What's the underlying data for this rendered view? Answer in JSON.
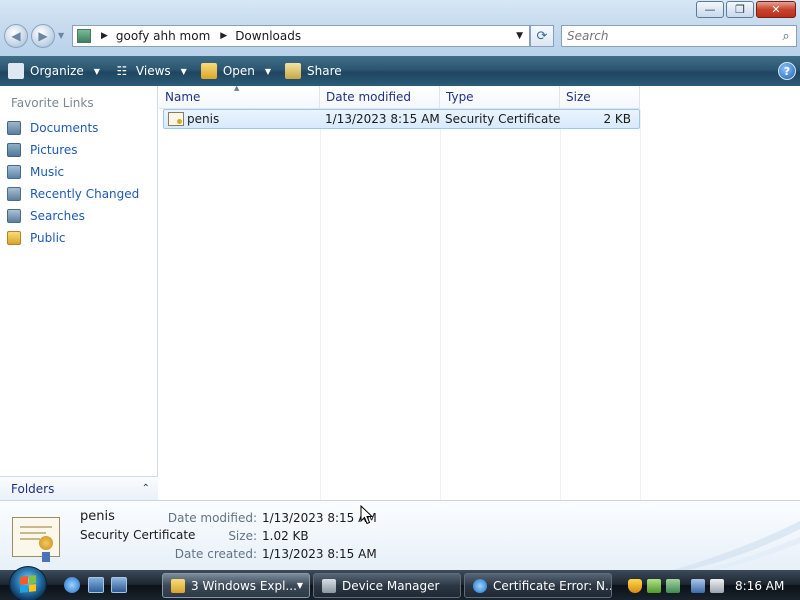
{
  "window": {
    "minimize_glyph": "—",
    "maximize_glyph": "❐",
    "close_glyph": "✕"
  },
  "address": {
    "crumbs": [
      "goofy ahh mom",
      "Downloads"
    ]
  },
  "search": {
    "placeholder": "Search"
  },
  "toolbar": {
    "organize_label": "Organize",
    "views_label": "Views",
    "open_label": "Open",
    "share_label": "Share",
    "help_label": "?"
  },
  "sidebar": {
    "heading": "Favorite Links",
    "items": [
      {
        "label": "Documents",
        "icon": "documents-icon"
      },
      {
        "label": "Pictures",
        "icon": "pictures-icon"
      },
      {
        "label": "Music",
        "icon": "music-icon"
      },
      {
        "label": "Recently Changed",
        "icon": "recently-changed-icon"
      },
      {
        "label": "Searches",
        "icon": "searches-icon"
      },
      {
        "label": "Public",
        "icon": "public-folder-icon"
      }
    ],
    "folders_label": "Folders"
  },
  "file_list": {
    "columns": [
      "Name",
      "Date modified",
      "Type",
      "Size"
    ],
    "rows": [
      {
        "name": "penis",
        "date_modified": "1/13/2023 8:15 AM",
        "type": "Security Certificate",
        "size": "2 KB",
        "selected": true
      }
    ]
  },
  "details": {
    "name": "penis",
    "type": "Security Certificate",
    "props": [
      {
        "label": "Date modified:",
        "value": "1/13/2023 8:15 AM"
      },
      {
        "label": "Size:",
        "value": "1.02 KB"
      },
      {
        "label": "Date created:",
        "value": "1/13/2023 8:15 AM"
      }
    ]
  },
  "taskbar": {
    "tasks": [
      {
        "label": "3 Windows Expl...",
        "active": true
      },
      {
        "label": "Device Manager",
        "active": false
      },
      {
        "label": "Certificate Error: N...",
        "active": false
      }
    ],
    "clock": "8:16 AM"
  },
  "colors": {
    "link": "#1d5ab5",
    "command_bar": "#2c5671",
    "selection": "#d7eafc",
    "taskbar": "#1d2630"
  }
}
